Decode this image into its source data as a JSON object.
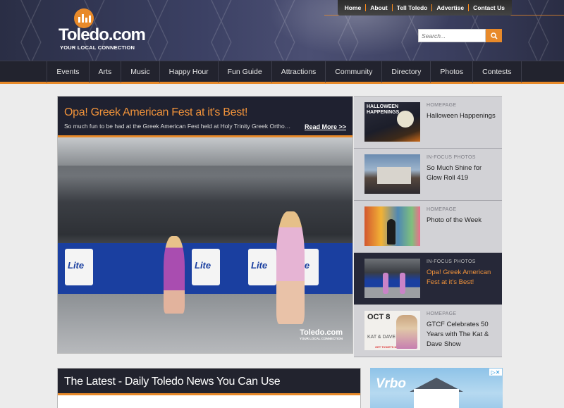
{
  "topnav": [
    "Home",
    "About",
    "Tell Toledo",
    "Advertise",
    "Contact Us"
  ],
  "logo": {
    "name": "Toledo.com",
    "tagline": "YOUR LOCAL CONNECTION"
  },
  "search": {
    "placeholder": "Search..."
  },
  "mainnav": [
    "Events",
    "Arts",
    "Music",
    "Happy Hour",
    "Fun Guide",
    "Attractions",
    "Community",
    "Directory",
    "Photos",
    "Contests"
  ],
  "featured": {
    "title": "Opa! Greek American Fest at it's Best!",
    "excerpt": "So much fun to be had at the Greek American Fest held at Holy Trinity Greek Orthodox Cathedral",
    "read_more": "Read More >>",
    "banner_text": "Lite",
    "watermark": "Toledo.com",
    "watermark_tag": "YOUR LOCAL CONNECTION"
  },
  "sidebar": {
    "items": [
      {
        "category": "HOMEPAGE",
        "title": "Halloween Happenings",
        "thumb_text": "HALLOWEEN HAPPENINGS"
      },
      {
        "category": "IN-FOCUS PHOTOS",
        "title": "So Much Shine for Glow Roll 419"
      },
      {
        "category": "HOMEPAGE",
        "title": "Photo of the Week"
      },
      {
        "category": "IN-FOCUS PHOTOS",
        "title": "Opa! Greek American Fest at it's Best!",
        "active": true
      },
      {
        "category": "HOMEPAGE",
        "title": "GTCF Celebrates 50 Years with The Kat & Dave Show",
        "thumb_date": "OCT 8",
        "thumb_names": "KAT & DAVE",
        "thumb_cta": "GET TICKETS NOW"
      }
    ]
  },
  "latest": {
    "title": "The Latest - Daily Toledo News You Can Use"
  },
  "ad": {
    "brand": "Vrbo",
    "choice": "▷✕"
  },
  "colors": {
    "accent": "#e88a2a",
    "nav_bg": "#22232e",
    "title_orange": "#f0923a"
  }
}
